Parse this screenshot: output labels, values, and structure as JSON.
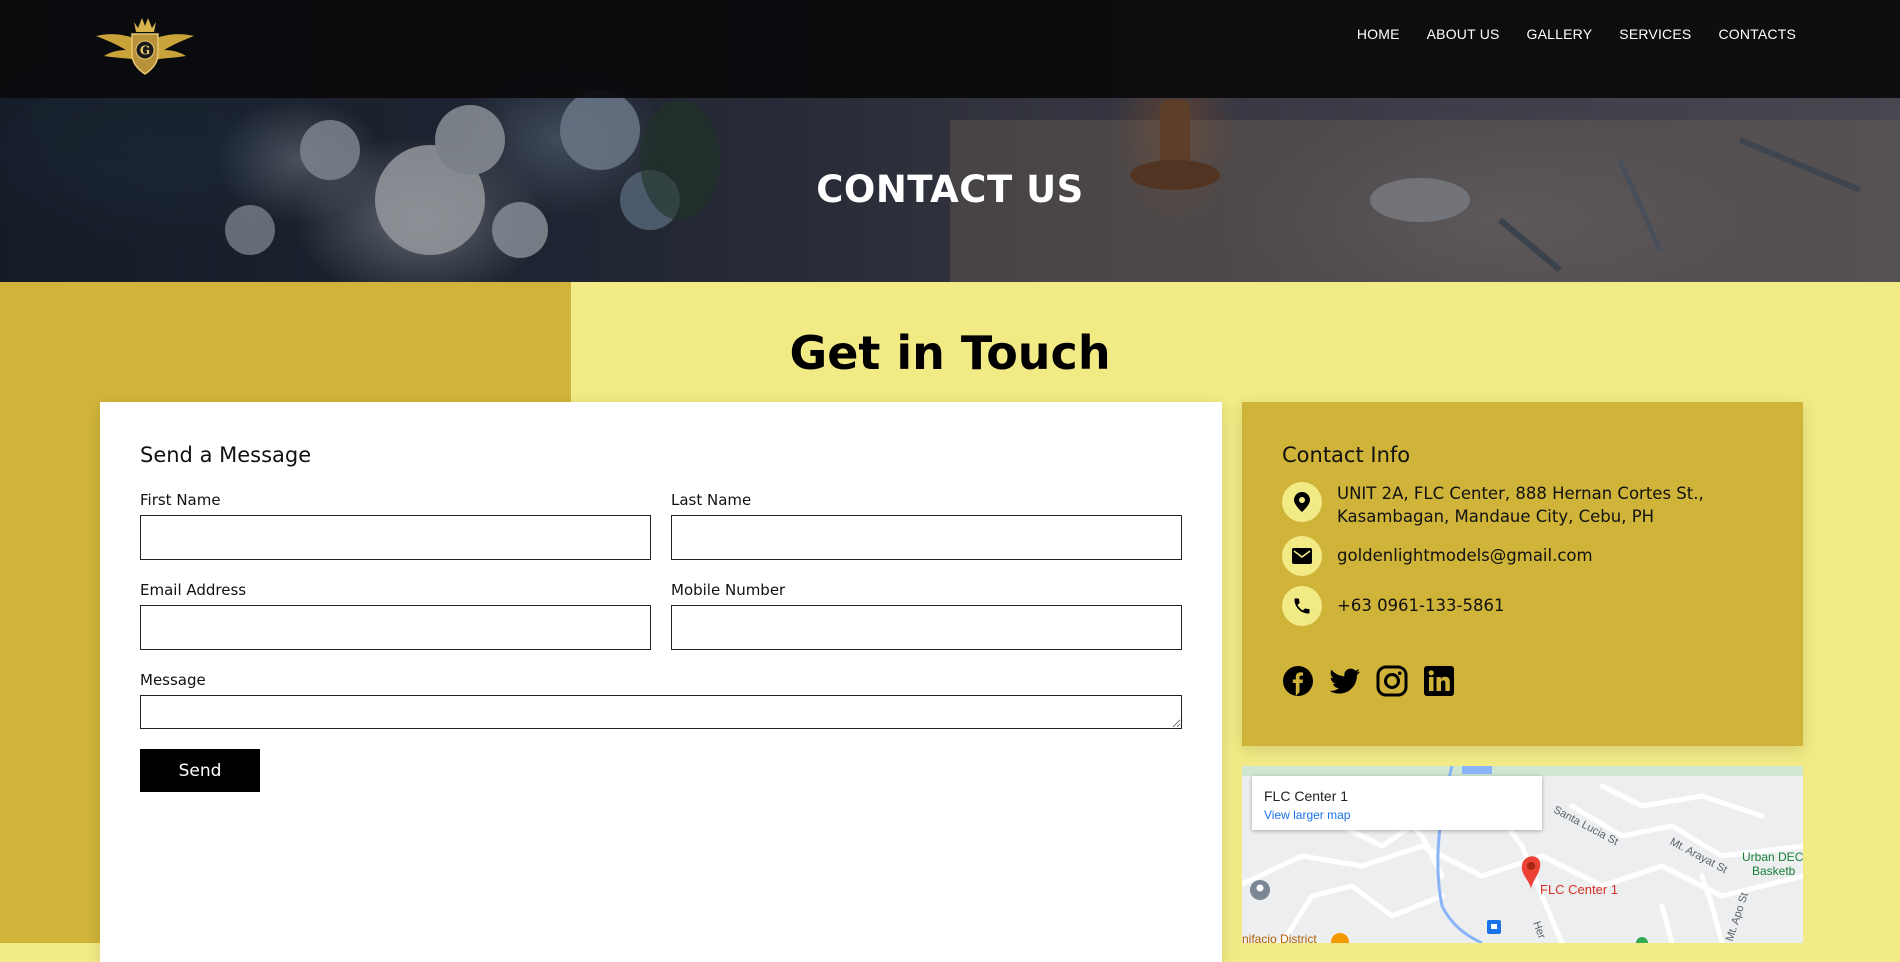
{
  "header": {
    "nav": [
      "HOME",
      "ABOUT US",
      "GALLERY",
      "SERVICES",
      "CONTACTS"
    ],
    "logo_letter": "G"
  },
  "hero": {
    "title": "CONTACT US"
  },
  "section": {
    "title": "Get in Touch"
  },
  "form": {
    "heading": "Send a Message",
    "first_name_label": "First Name",
    "last_name_label": "Last Name",
    "email_label": "Email Address",
    "mobile_label": "Mobile Number",
    "message_label": "Message",
    "first_name_value": "",
    "last_name_value": "",
    "email_value": "",
    "mobile_value": "",
    "message_value": "",
    "send_label": "Send"
  },
  "contact_info": {
    "heading": "Contact Info",
    "address_line1": "UNIT 2A, FLC Center, 888 Hernan Cortes St.,",
    "address_line2": "Kasambagan, Mandaue City, Cebu, PH",
    "email": "goldenlightmodels@gmail.com",
    "phone": "+63 0961-133-5861",
    "social_icons": [
      "facebook-icon",
      "twitter-icon",
      "instagram-icon",
      "linkedin-icon"
    ]
  },
  "map": {
    "place_name": "FLC Center 1",
    "view_larger": "View larger map",
    "pin_label": "FLC Center 1",
    "streets": [
      "Santa Lucia St",
      "Mt. Arayat St",
      "Mt. Apo St",
      "Urban DEC",
      "Basketb",
      "Her",
      "nifacio District"
    ]
  },
  "colors": {
    "accent_dark": "#d0b43a",
    "accent_light": "#f2ea85",
    "nav_bg": "#0a0a0c",
    "button_bg": "#000000"
  }
}
